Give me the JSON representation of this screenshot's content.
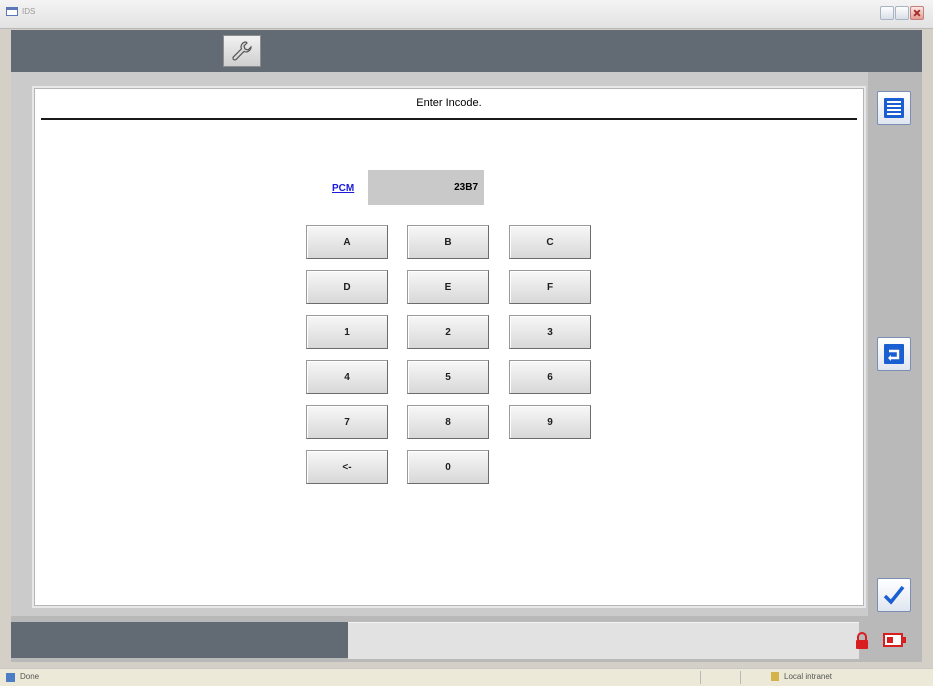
{
  "window": {
    "title": "IDS"
  },
  "dialog": {
    "title": "Enter Incode."
  },
  "module": {
    "link_label": "PCM",
    "value": "23B7"
  },
  "keypad": {
    "keys": [
      "A",
      "B",
      "C",
      "D",
      "E",
      "F",
      "1",
      "2",
      "3",
      "4",
      "5",
      "6",
      "7",
      "8",
      "9",
      "<-",
      "0"
    ]
  },
  "status": {
    "left_text": "Done",
    "zone_text": "Local intranet"
  },
  "colors": {
    "bar": "#626b74",
    "accent": "#1a5fd1",
    "lock": "#d81e1e"
  },
  "icons": {
    "tool": "wrench-icon",
    "list": "list-icon",
    "back": "return-icon",
    "confirm": "checkmark-icon",
    "lock": "lock-icon",
    "battery": "battery-icon"
  }
}
